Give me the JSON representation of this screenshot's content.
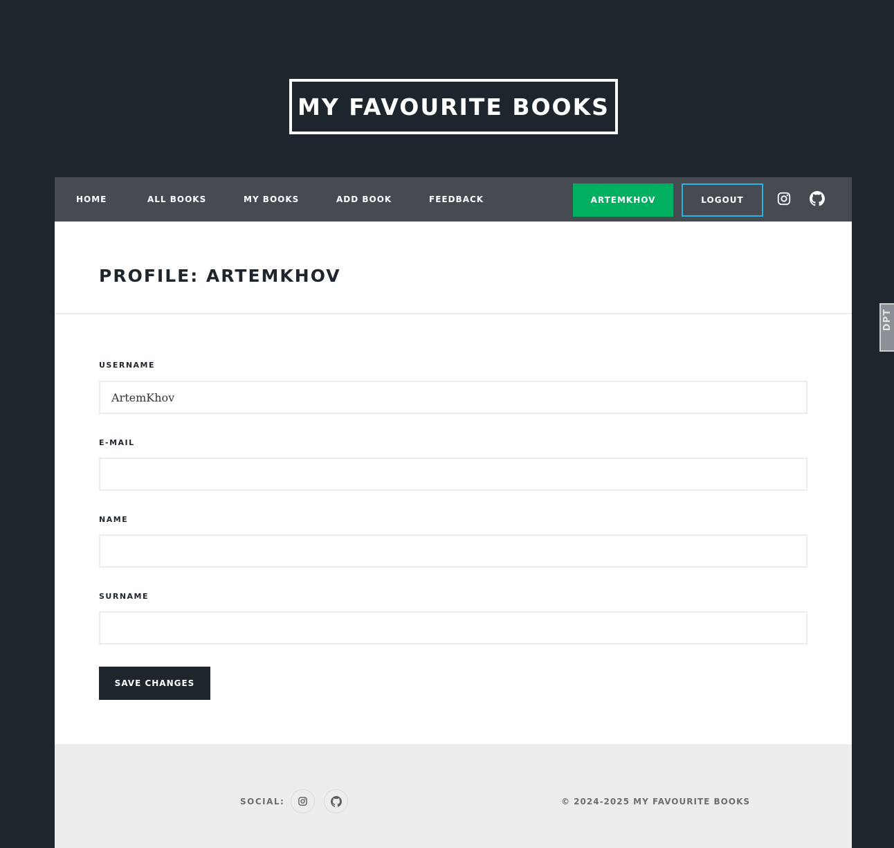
{
  "site": {
    "title": "MY FAVOURITE BOOKS"
  },
  "nav": {
    "items": [
      {
        "label": "HOME"
      },
      {
        "label": "ALL BOOKS"
      },
      {
        "label": "MY BOOKS"
      },
      {
        "label": "ADD BOOK"
      },
      {
        "label": "FEEDBACK"
      }
    ],
    "user_label": "ARTEMKHOV",
    "logout_label": "LOGOUT",
    "icons": [
      "instagram-icon",
      "github-icon"
    ]
  },
  "profile": {
    "title": "PROFILE: ARTEMKHOV",
    "fields": [
      {
        "label": "USERNAME",
        "value": "ArtemKhov"
      },
      {
        "label": "E-MAIL",
        "value": ""
      },
      {
        "label": "NAME",
        "value": ""
      },
      {
        "label": "SURNAME",
        "value": ""
      }
    ],
    "save_label": "SAVE CHANGES"
  },
  "footer": {
    "social_label": "SOCIAL:",
    "copyright": "© 2024-2025 MY FAVOURITE BOOKS",
    "icons": [
      "instagram-icon",
      "github-icon"
    ]
  },
  "side_tab": {
    "text": "DPT"
  },
  "colors": {
    "background": "#1f252d",
    "nav_background": "#464b52",
    "user_button": "#00b060",
    "logout_border": "#2ab4e6",
    "footer_background": "#ededed"
  }
}
